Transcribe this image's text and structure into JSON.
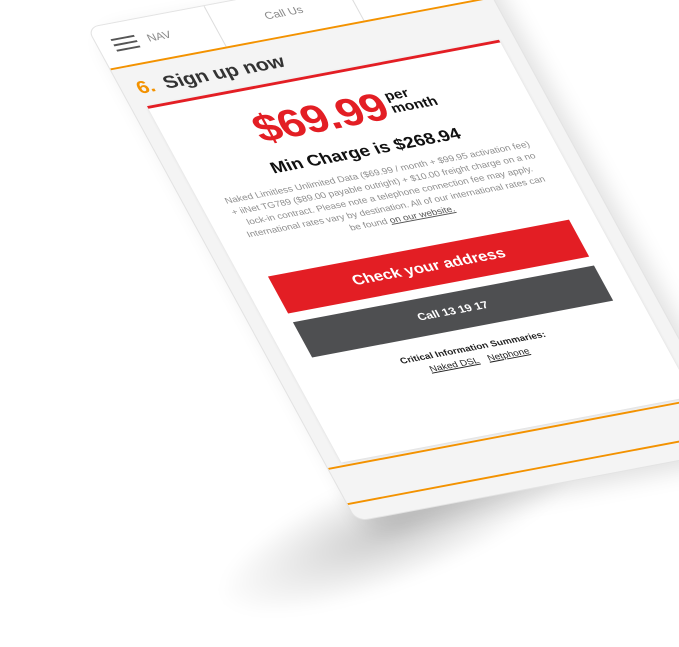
{
  "nav": {
    "menu_label": "NAV",
    "call_label": "Call Us",
    "menu_icon": "hamburger-icon",
    "search_icon": "search-icon"
  },
  "section": {
    "number": "6.",
    "title": "Sign up now"
  },
  "plan": {
    "price": "$69.99",
    "per_label_1": "per",
    "per_label_2": "month",
    "min_charge": "Min Charge is $268.94",
    "fine_print": "Naked Limitless Unlimited Data ($69.99 / month + $99.95 activation fee) + iiNet TG789 ($89.00 payable outright) + $10.00 freight charge on a no lock-in contract. Please note a telephone connection fee may apply. International rates vary by destination. All of our international rates can be found ",
    "fine_print_link": "on our website."
  },
  "actions": {
    "check_address": "Check your address",
    "call_number": "Call 13 19 17"
  },
  "cis": {
    "title": "Critical Information Summaries:",
    "links": [
      "Naked DSL",
      "Netphone"
    ]
  },
  "colors": {
    "brand_red": "#e31e24",
    "accent_orange": "#f39200",
    "button_dark": "#4e4f51"
  }
}
